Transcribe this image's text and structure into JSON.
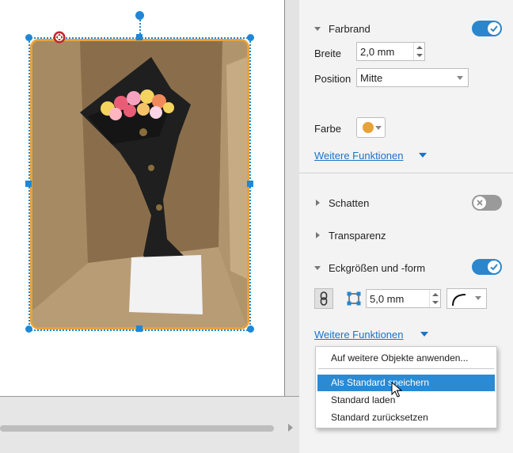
{
  "panel": {
    "farbrand": {
      "title": "Farbrand",
      "enabled": true,
      "breite_label": "Breite",
      "breite_value": "2,0 mm",
      "position_label": "Position",
      "position_value": "Mitte",
      "farbe_label": "Farbe",
      "farbe_color": "#e8a23a",
      "more_link": "Weitere Funktionen"
    },
    "schatten": {
      "title": "Schatten",
      "enabled": false
    },
    "transparenz": {
      "title": "Transparenz"
    },
    "ecken": {
      "title": "Eckgrößen und -form",
      "enabled": true,
      "size_value": "5,0 mm",
      "more_link": "Weitere Funktionen"
    }
  },
  "menu": {
    "items": [
      "Auf weitere Objekte anwenden...",
      "Als Standard speichern",
      "Standard laden",
      "Standard zurücksetzen"
    ],
    "active_index": 1
  },
  "colors": {
    "accent": "#2b86cc",
    "selection": "#1e88d6",
    "frame": "#e8a23a",
    "link": "#1a73c7"
  }
}
